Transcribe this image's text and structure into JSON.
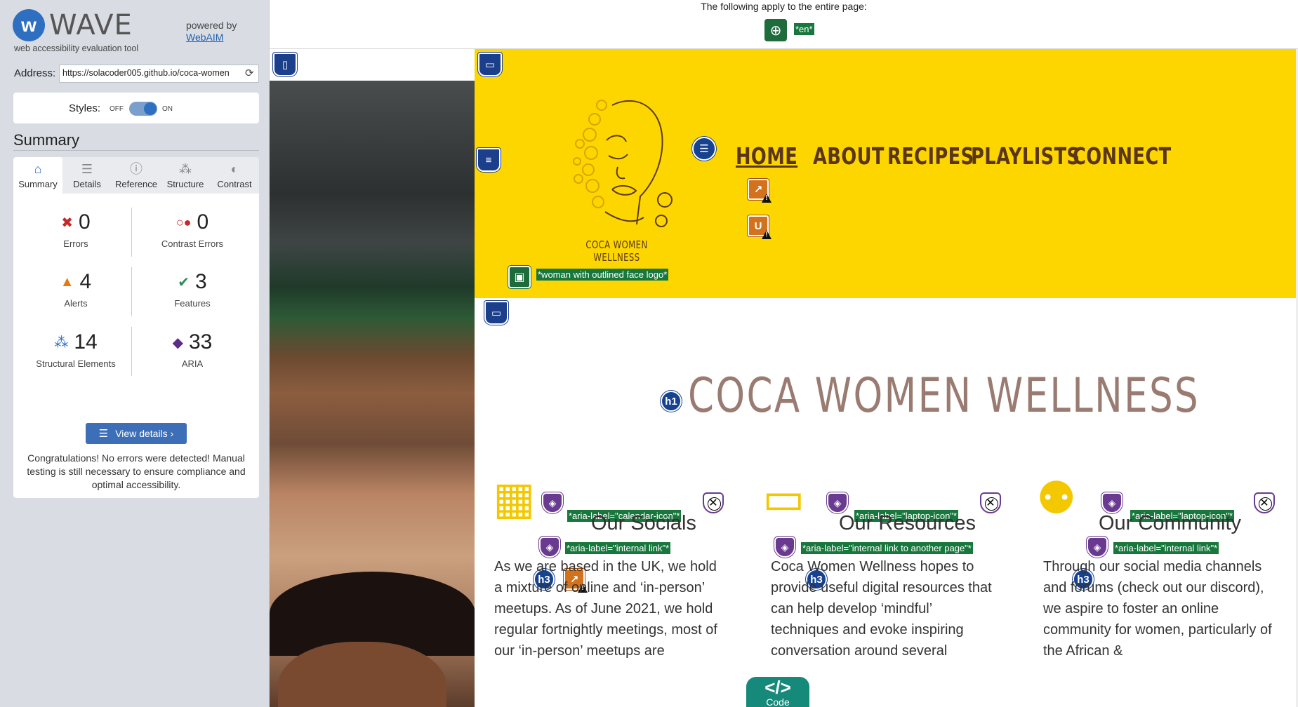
{
  "wave": {
    "brand": "WAVE",
    "tagline": "web accessibility evaluation tool",
    "powered_by": "powered by",
    "webaim": "WebAIM",
    "address_label": "Address:",
    "address_value": "https://solacoder005.github.io/coca-women",
    "styles_label": "Styles:",
    "styles_off": "OFF",
    "styles_on": "ON",
    "summary_heading": "Summary",
    "tabs": [
      {
        "label": "Summary",
        "icon": "home-icon"
      },
      {
        "label": "Details",
        "icon": "list-icon"
      },
      {
        "label": "Reference",
        "icon": "info-icon"
      },
      {
        "label": "Structure",
        "icon": "structure-icon"
      },
      {
        "label": "Contrast",
        "icon": "contrast-icon"
      }
    ],
    "stats": {
      "errors": {
        "value": "0",
        "label": "Errors"
      },
      "contrast": {
        "value": "0",
        "label": "Contrast Errors"
      },
      "alerts": {
        "value": "4",
        "label": "Alerts"
      },
      "features": {
        "value": "3",
        "label": "Features"
      },
      "structural": {
        "value": "14",
        "label": "Structural Elements"
      },
      "aria": {
        "value": "33",
        "label": "ARIA"
      }
    },
    "view_details": "View details ›",
    "congrats": "Congratulations! No errors were detected! Manual testing is still necessary to ensure compliance and optimal accessibility."
  },
  "topbar": {
    "apply_text": "The following apply to the entire page:",
    "lang_tag": "*en*"
  },
  "site": {
    "logo_name": "COCA WOMEN WELLNESS",
    "logo_alt_tag": "*woman with outlined face logo*",
    "nav": [
      "HOME",
      "ABOUT",
      "RECIPES",
      "PLAYLISTS",
      "CONNECT"
    ],
    "h1": "COCA WOMEN WELLNESS",
    "h1_marker": "h1",
    "h3_marker": "h3",
    "columns": [
      {
        "aria_icon": "*aria-label=\"calendar-icon\"*",
        "aria_link": "*aria-label=\"internal link\"*",
        "heading": "Our Socials",
        "text": "As we are based in the UK, we hold a mixture of online and ‘in-person’ meetups. As of June 2021, we hold regular fortnightly meetings, most of our ‘in-person’ meetups are"
      },
      {
        "aria_icon": "*aria-label=\"laptop-icon\"*",
        "aria_link": "*aria-label=\"internal link to another page\"*",
        "heading": "Our Resources",
        "text": "Coca Women Wellness hopes to provide useful digital resources that can help develop ‘mindful’ techniques and evoke inspiring conversation around several"
      },
      {
        "aria_icon": "*aria-label=\"laptop-icon\"*",
        "aria_link": "*aria-label=\"internal link\"*",
        "heading": "Our Community",
        "text": "Through our social media channels and forums (check out our discord), we aspire to foster an online community for women, particularly of the African &"
      }
    ],
    "code_button": "Code",
    "code_glyph": "</>"
  },
  "colors": {
    "header_bg": "#fdd600",
    "nav_text": "#5a3617",
    "title": "#9a7b71",
    "wave_blue": "#2f6fc1",
    "aria_purple": "#6a3a91",
    "feature_green": "#18773c",
    "alert_orange": "#d2721c"
  }
}
